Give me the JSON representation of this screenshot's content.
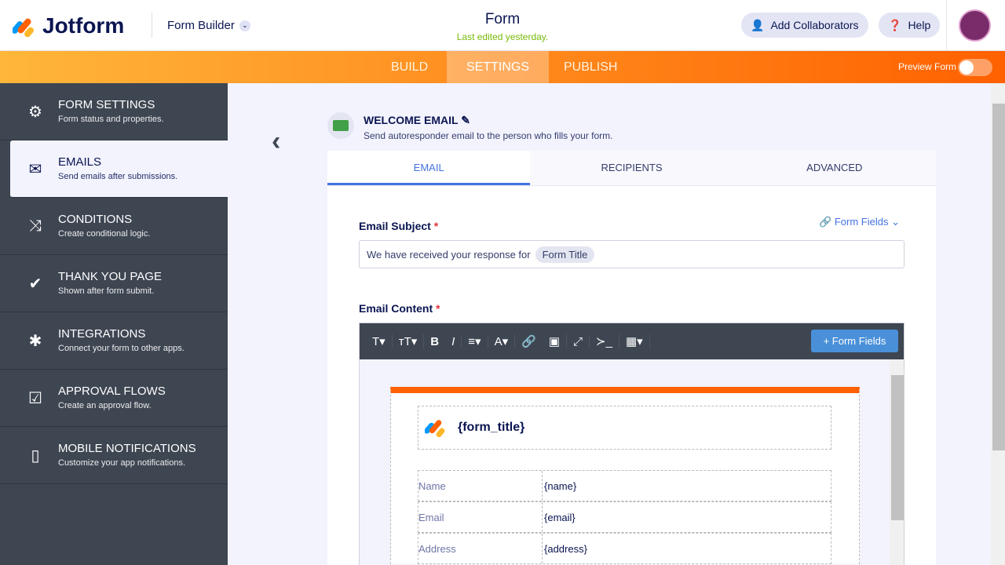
{
  "header": {
    "brand": "Jotform",
    "builder": "Form Builder",
    "title": "Form",
    "subtitle": "Last edited yesterday.",
    "add_collab": "Add Collaborators",
    "help": "Help"
  },
  "nav": {
    "tabs": [
      "BUILD",
      "SETTINGS",
      "PUBLISH"
    ],
    "preview": "Preview Form"
  },
  "sidebar": [
    {
      "title": "FORM SETTINGS",
      "desc": "Form status and properties.",
      "icon": "⚙"
    },
    {
      "title": "EMAILS",
      "desc": "Send emails after submissions.",
      "icon": "✉"
    },
    {
      "title": "CONDITIONS",
      "desc": "Create conditional logic.",
      "icon": "⤨"
    },
    {
      "title": "THANK YOU PAGE",
      "desc": "Shown after form submit.",
      "icon": "✔"
    },
    {
      "title": "INTEGRATIONS",
      "desc": "Connect your form to other apps.",
      "icon": "✱"
    },
    {
      "title": "APPROVAL FLOWS",
      "desc": "Create an approval flow.",
      "icon": "☑"
    },
    {
      "title": "MOBILE NOTIFICATIONS",
      "desc": "Customize your app notifications.",
      "icon": "▯"
    }
  ],
  "email": {
    "title": "WELCOME EMAIL",
    "desc": "Send autoresponder email to the person who fills your form.",
    "tabs": [
      "EMAIL",
      "RECIPIENTS",
      "ADVANCED"
    ],
    "subject_label": "Email Subject",
    "form_fields": "Form Fields",
    "subject_text": "We have received your response for",
    "subject_chip": "Form Title",
    "content_label": "Email Content",
    "add_fields": "+ Form Fields",
    "form_title": "{form_title}",
    "rows": [
      {
        "k": "Name",
        "v": "{name}"
      },
      {
        "k": "Email",
        "v": "{email}"
      },
      {
        "k": "Address",
        "v": "{address}"
      }
    ]
  },
  "toolbar": [
    "T▾",
    "тT▾",
    "B",
    "I",
    "≡▾",
    "A▾",
    "🔗",
    "▣",
    "⤢",
    "≻_",
    "▦▾"
  ]
}
